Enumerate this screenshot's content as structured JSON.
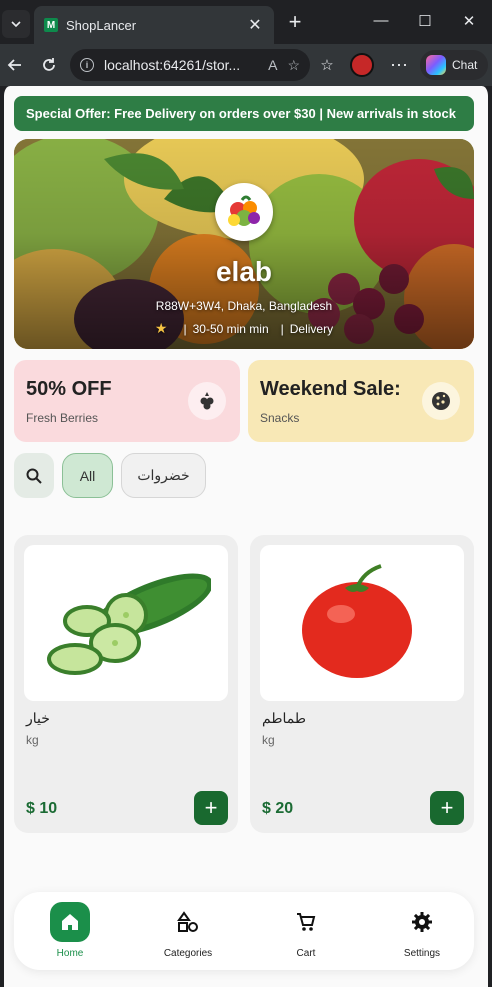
{
  "browser": {
    "tab_title": "ShopLancer",
    "tab_favicon_letter": "M",
    "url": "localhost:64261/stor...",
    "chat_label": "Chat"
  },
  "page": {
    "promo_banner": "Special Offer: Free Delivery on orders over $30 | New arrivals in stock",
    "store": {
      "name": "elab",
      "address": "R88W+3W4, Dhaka, Bangladesh",
      "delivery_time": "30-50 min min",
      "service": "Delivery",
      "separator": "|"
    },
    "offers": [
      {
        "title": "50% OFF",
        "subtitle": "Fresh Berries",
        "icon": "berry-icon",
        "bg": "#fadadd"
      },
      {
        "title": "Weekend Sale:",
        "subtitle": "Snacks",
        "icon": "cookie-icon",
        "bg": "#f8e8b6"
      }
    ],
    "categories": {
      "all_label": "All",
      "veg_label": "خضروات"
    },
    "products": [
      {
        "name": "خيار",
        "unit": "kg",
        "price": "$ 10",
        "image": "cucumber"
      },
      {
        "name": "طماطم",
        "unit": "kg",
        "price": "$ 20",
        "image": "tomato"
      }
    ],
    "nav": [
      {
        "label": "Home",
        "icon": "home-icon",
        "active": true
      },
      {
        "label": "Categories",
        "icon": "categories-icon",
        "active": false
      },
      {
        "label": "Cart",
        "icon": "cart-icon",
        "active": false
      },
      {
        "label": "Settings",
        "icon": "settings-icon",
        "active": false
      }
    ],
    "accent_color": "#1b8f4a"
  }
}
